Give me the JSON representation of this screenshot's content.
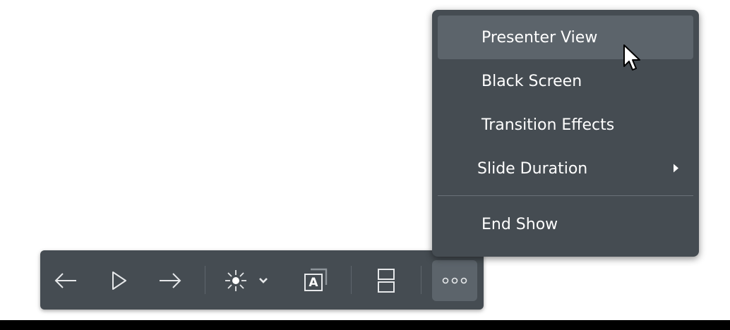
{
  "colors": {
    "panel_bg": "#454c52",
    "highlight_bg": "#5c646b",
    "text": "#ffffff",
    "icon": "#e6e8ea"
  },
  "toolbar": {
    "buttons": [
      {
        "name": "previous-slide-button",
        "icon": "arrow-left-icon"
      },
      {
        "name": "play-button",
        "icon": "play-icon"
      },
      {
        "name": "next-slide-button",
        "icon": "arrow-right-icon"
      },
      {
        "name": "laser-pointer-button",
        "icon": "laser-pointer-icon"
      },
      {
        "name": "pointer-options-dropdown",
        "icon": "chevron-down-icon"
      },
      {
        "name": "subtitles-button",
        "icon": "subtitles-icon"
      },
      {
        "name": "slide-sorter-button",
        "icon": "slide-sorter-icon"
      },
      {
        "name": "more-options-button",
        "icon": "more-icon"
      }
    ],
    "subtitle_glyph": "A"
  },
  "menu": {
    "items": [
      {
        "label": "Presenter View",
        "highlighted": true
      },
      {
        "label": "Black Screen"
      },
      {
        "label": "Transition Effects"
      },
      {
        "label": "Slide Duration",
        "has_submenu": true
      },
      {
        "label": "End Show"
      }
    ]
  }
}
